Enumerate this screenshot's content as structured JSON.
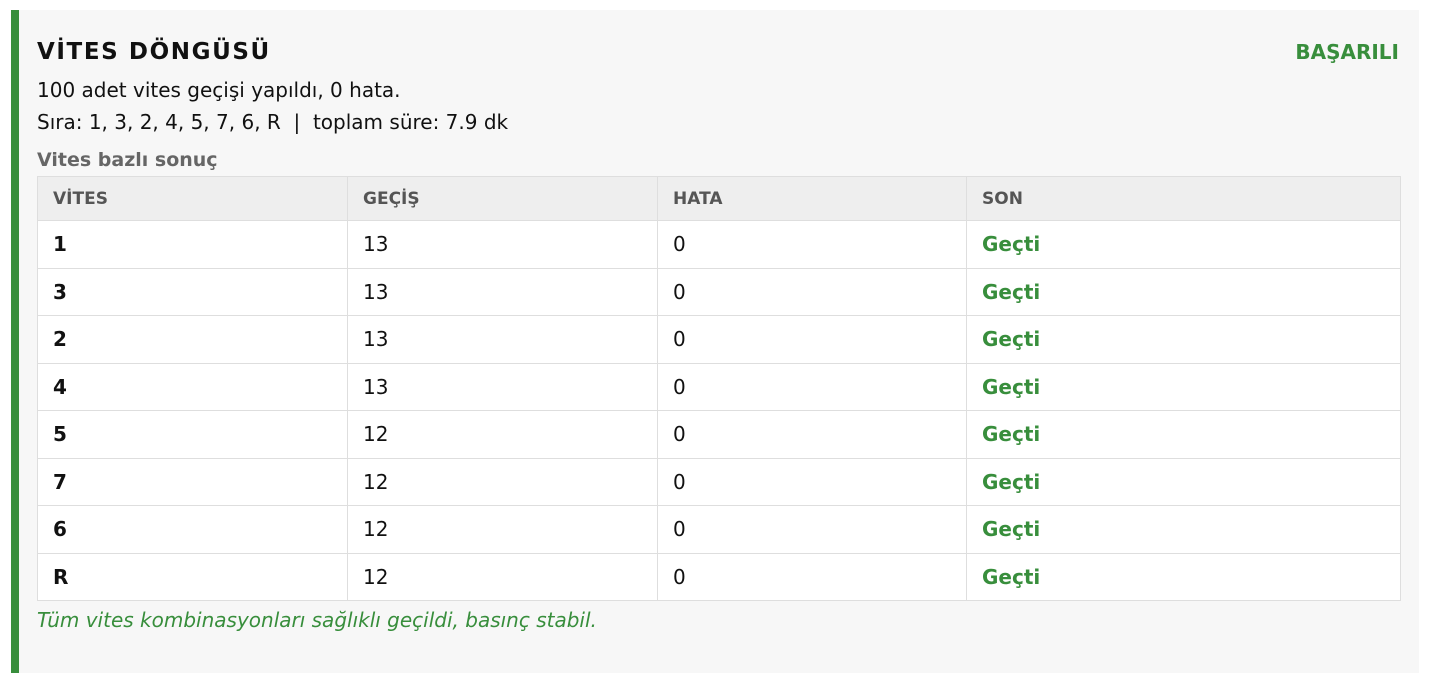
{
  "panel": {
    "title": "VİTES DÖNGÜSÜ",
    "status": "BAŞARILI",
    "summary_line1": "100 adet vites geçişi yapıldı, 0 hata.",
    "summary_line2": "Sıra: 1, 3, 2, 4, 5, 7, 6, R  |  toplam süre: 7.9 dk",
    "section_label": "Vites bazlı sonuç",
    "footnote": "Tüm vites kombinasyonları sağlıklı geçildi, basınç stabil."
  },
  "table": {
    "headers": [
      "VİTES",
      "GEÇİŞ",
      "HATA",
      "SON"
    ],
    "rows": [
      {
        "gear": "1",
        "shifts": "13",
        "errors": "0",
        "result": "Geçti"
      },
      {
        "gear": "3",
        "shifts": "13",
        "errors": "0",
        "result": "Geçti"
      },
      {
        "gear": "2",
        "shifts": "13",
        "errors": "0",
        "result": "Geçti"
      },
      {
        "gear": "4",
        "shifts": "13",
        "errors": "0",
        "result": "Geçti"
      },
      {
        "gear": "5",
        "shifts": "12",
        "errors": "0",
        "result": "Geçti"
      },
      {
        "gear": "7",
        "shifts": "12",
        "errors": "0",
        "result": "Geçti"
      },
      {
        "gear": "6",
        "shifts": "12",
        "errors": "0",
        "result": "Geçti"
      },
      {
        "gear": "R",
        "shifts": "12",
        "errors": "0",
        "result": "Geçti"
      }
    ]
  },
  "colors": {
    "accent": "#388e3c",
    "panel_bg": "#f7f7f7",
    "header_bg": "#eeeeee",
    "border": "#dedede"
  }
}
